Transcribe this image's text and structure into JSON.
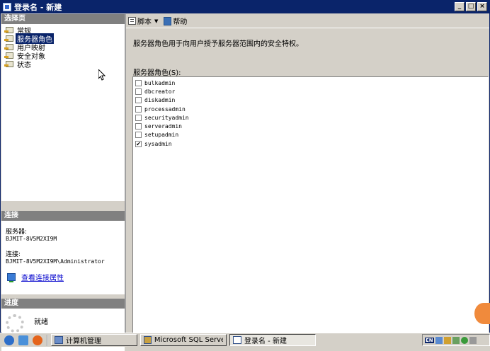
{
  "window": {
    "title": "登录名 - 新建"
  },
  "left": {
    "pages_header": "选择页",
    "pages": [
      {
        "label": "常规",
        "selected": false
      },
      {
        "label": "服务器角色",
        "selected": true
      },
      {
        "label": "用户映射",
        "selected": false
      },
      {
        "label": "安全对象",
        "selected": false
      },
      {
        "label": "状态",
        "selected": false
      }
    ],
    "connection_header": "连接",
    "server_label": "服务器:",
    "server_value": "BJMIT-8V5M2XI9M",
    "connection_label": "连接:",
    "connection_value": "BJMIT-8V5M2XI9M\\Administrator",
    "connection_link": "查看连接属性",
    "progress_header": "进度",
    "progress_status": "就绪"
  },
  "toolbar": {
    "script_label": "脚本",
    "help_label": "帮助"
  },
  "main": {
    "description": "服务器角色用于向用户授予服务器范围内的安全特权。",
    "roles_label": "服务器角色(S):",
    "roles": [
      {
        "name": "bulkadmin",
        "checked": false
      },
      {
        "name": "dbcreator",
        "checked": false
      },
      {
        "name": "diskadmin",
        "checked": false
      },
      {
        "name": "processadmin",
        "checked": false
      },
      {
        "name": "securityadmin",
        "checked": false
      },
      {
        "name": "serveradmin",
        "checked": false
      },
      {
        "name": "setupadmin",
        "checked": false
      },
      {
        "name": "sysadmin",
        "checked": true
      }
    ]
  },
  "taskbar": {
    "tasks": [
      {
        "label": "计算机管理",
        "active": false
      },
      {
        "label": "Microsoft SQL Serve...",
        "active": false
      },
      {
        "label": "登录名 - 新建",
        "active": true
      }
    ],
    "tray_lang": "EN"
  },
  "icons": {
    "quick_launch": [
      "ie-icon",
      "show-desktop-icon",
      "firefox-icon"
    ]
  }
}
